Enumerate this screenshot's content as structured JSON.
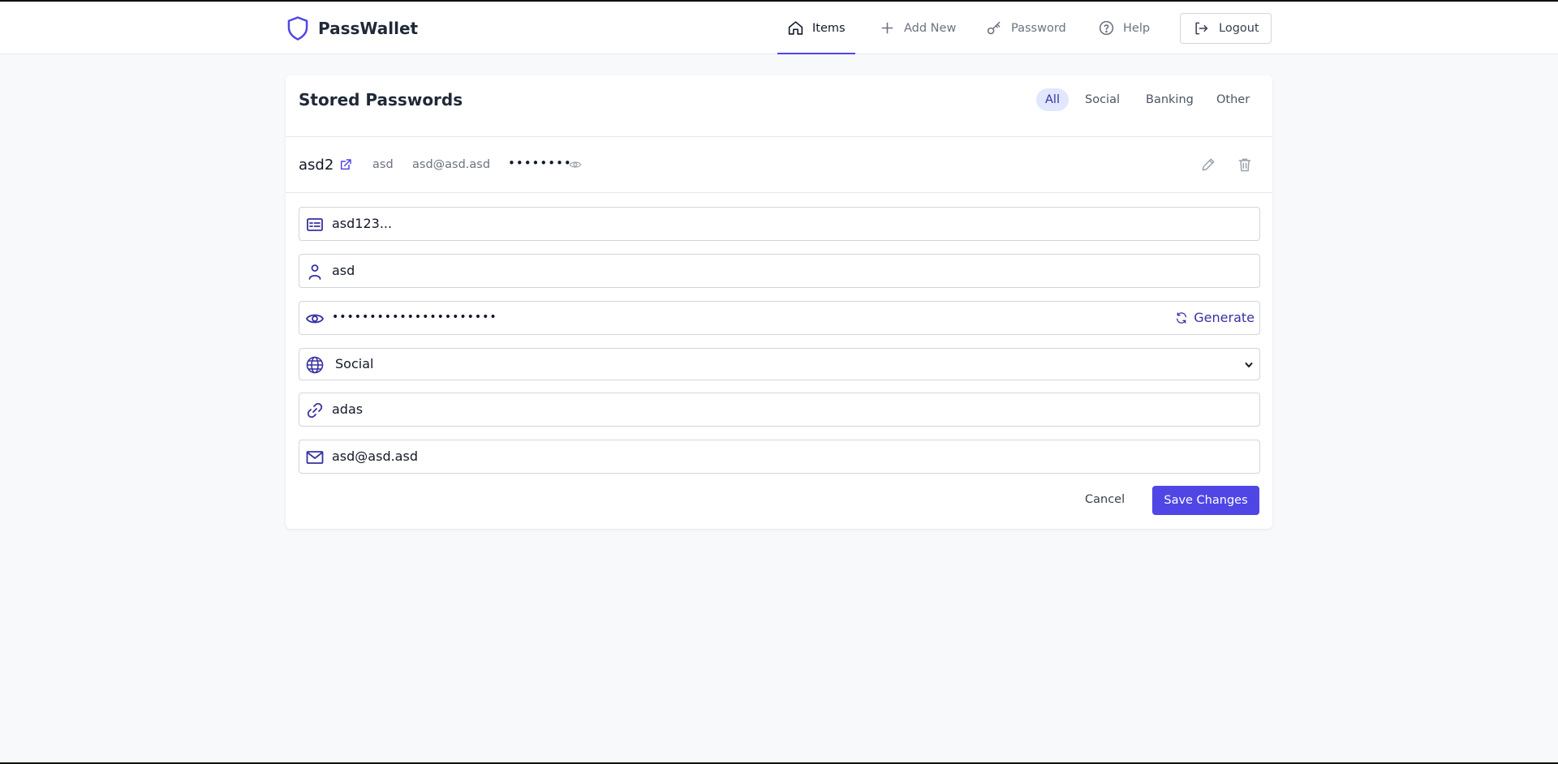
{
  "app": {
    "name": "PassWallet",
    "logo_icon": "shield-icon",
    "accent_color": "#4f46e5"
  },
  "nav": {
    "items": [
      {
        "label": "Items",
        "icon": "home-icon",
        "active": true
      },
      {
        "label": "Add New",
        "icon": "plus-icon",
        "active": false
      },
      {
        "label": "Password",
        "icon": "key-icon",
        "active": false
      },
      {
        "label": "Help",
        "icon": "help-circle-icon",
        "active": false
      }
    ],
    "logout_label": "Logout"
  },
  "main": {
    "title": "Stored Passwords",
    "filters": [
      {
        "label": "All",
        "active": true
      },
      {
        "label": "Social",
        "active": false
      },
      {
        "label": "Banking",
        "active": false
      },
      {
        "label": "Other",
        "active": false
      }
    ],
    "entry": {
      "name": "asd2",
      "username": "asd",
      "email": "asd@asd.asd",
      "masked_password": "••••••••"
    },
    "form": {
      "title_value": "asd123...",
      "username_value": "asd",
      "password_value": "••••••••••••••••••••••",
      "generate_label": "Generate",
      "category_value": "Social",
      "url_value": "adas",
      "email_value": "asd@asd.asd",
      "cancel_label": "Cancel",
      "save_label": "Save Changes"
    }
  }
}
